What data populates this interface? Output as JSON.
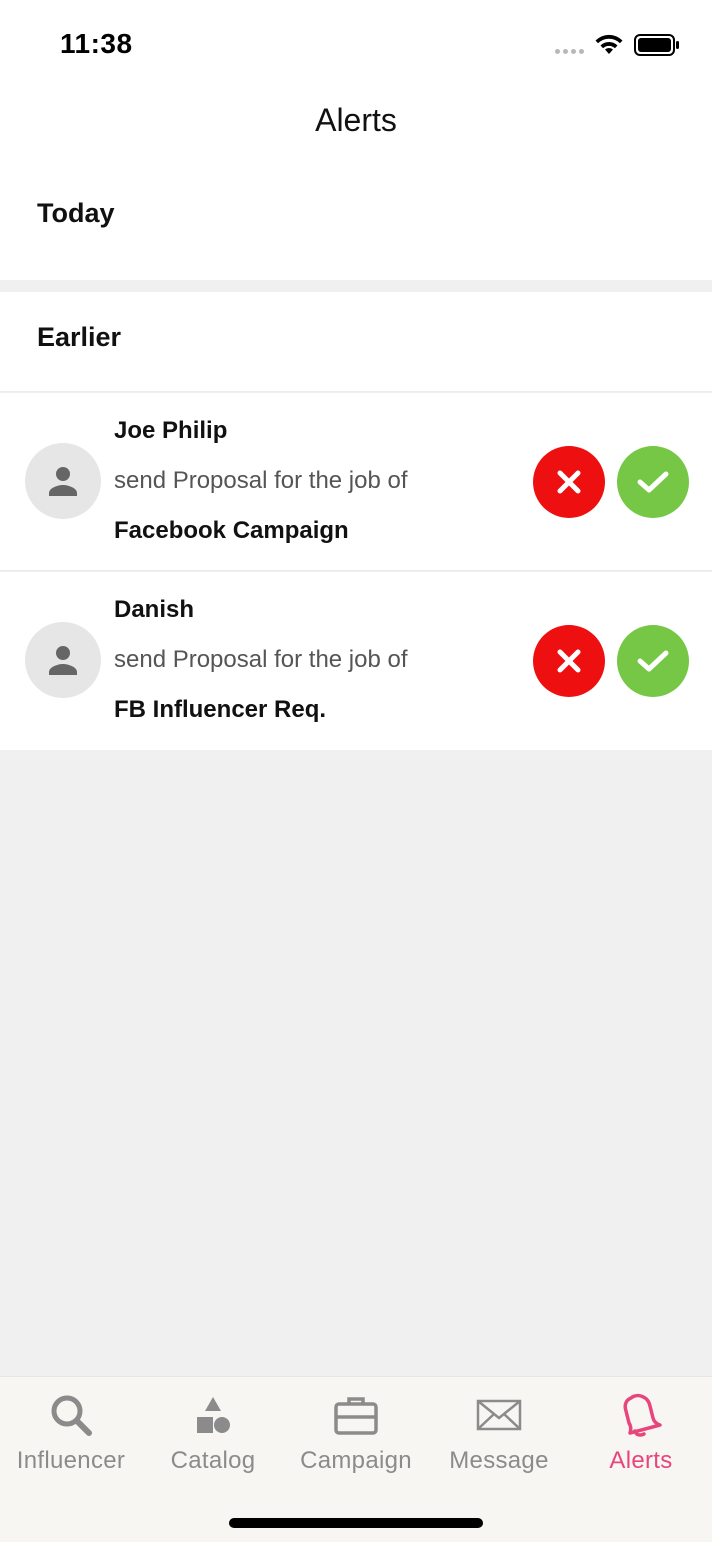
{
  "status_bar": {
    "time": "11:38"
  },
  "header": {
    "title": "Alerts"
  },
  "sections": {
    "today": "Today",
    "earlier": "Earlier"
  },
  "alerts": [
    {
      "name": "Joe Philip",
      "description": "send Proposal for the job of",
      "job": "Facebook Campaign"
    },
    {
      "name": "Danish",
      "description": "send Proposal for the job of",
      "job": "FB Influencer Req."
    }
  ],
  "tabs": [
    {
      "label": "Influencer",
      "icon": "search-icon"
    },
    {
      "label": "Catalog",
      "icon": "shapes-icon"
    },
    {
      "label": "Campaign",
      "icon": "briefcase-icon"
    },
    {
      "label": "Message",
      "icon": "envelope-icon"
    },
    {
      "label": "Alerts",
      "icon": "bell-icon",
      "active": true
    }
  ],
  "colors": {
    "reject": "#ee1010",
    "accept": "#76c745",
    "active_tab": "#e8457c",
    "inactive_tab": "#8b8b8b"
  }
}
